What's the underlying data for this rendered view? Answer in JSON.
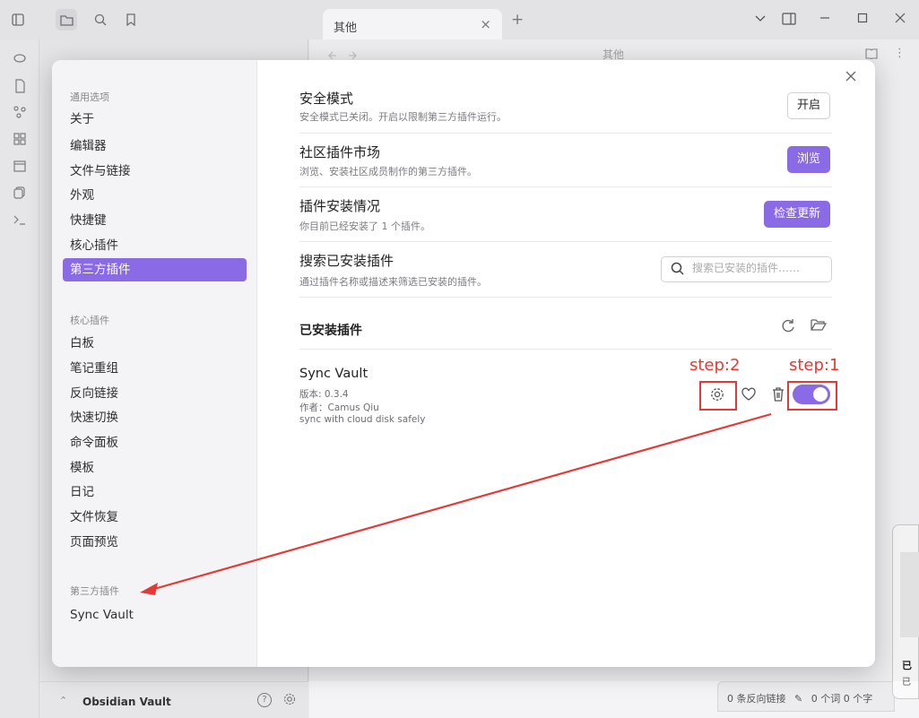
{
  "titlebar": {
    "tab_label": "其他",
    "tab_close": "×",
    "new_tab": "+",
    "nav_title": "其他"
  },
  "vault": {
    "name": "Obsidian Vault",
    "help": "?"
  },
  "statusbar": {
    "backlinks": "0 条反向链接",
    "words": "0 个词",
    "chars": "0 个字"
  },
  "notice": {
    "title": "已",
    "body": "已"
  },
  "modal": {
    "nav": {
      "group_general": "通用选项",
      "general": [
        "关于",
        "编辑器",
        "文件与链接",
        "外观",
        "快捷键",
        "核心插件",
        "第三方插件"
      ],
      "group_core": "核心插件",
      "core": [
        "白板",
        "笔记重组",
        "反向链接",
        "快速切换",
        "命令面板",
        "模板",
        "日记",
        "文件恢复",
        "页面预览"
      ],
      "group_thirdparty": "第三方插件",
      "thirdparty": [
        "Sync Vault"
      ]
    },
    "rows": [
      {
        "name": "安全模式",
        "desc": "安全模式已关闭。开启以限制第三方插件运行。",
        "button": "开启"
      },
      {
        "name": "社区插件市场",
        "desc": "浏览、安装社区成员制作的第三方插件。",
        "button": "浏览"
      },
      {
        "name": "插件安装情况",
        "desc": "你目前已经安装了 1 个插件。",
        "button": "检查更新"
      },
      {
        "name": "搜索已安装插件",
        "desc": "通过插件名称或描述来筛选已安装的插件。",
        "placeholder": "搜索已安装的插件……"
      }
    ],
    "installed_title": "已安装插件",
    "plugin": {
      "name": "Sync Vault",
      "version": "版本: 0.3.4",
      "author": "作者：Camus Qiu",
      "description": "sync with cloud disk safely",
      "enabled": true
    }
  },
  "annotations": {
    "step1": "step:1",
    "step2": "step:2",
    "color": "#e53935"
  },
  "colors": {
    "accent": "#8b6ae6"
  },
  "icons": [
    "sidebar-toggle-icon",
    "folder-icon",
    "search-icon",
    "bookmark-icon",
    "graph-icon",
    "gear-icon",
    "heart-icon",
    "trash-icon",
    "refresh-icon",
    "open-folder-icon"
  ]
}
